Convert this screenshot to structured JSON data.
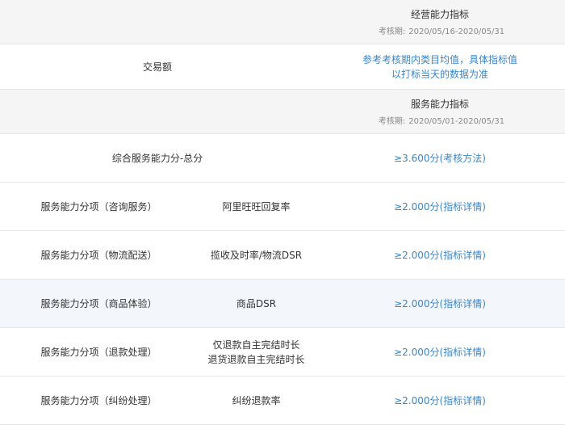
{
  "sections": {
    "business": {
      "title": "经营能力指标",
      "period_label": "考核期:",
      "period_value": "2020/05/16-2020/05/31"
    },
    "service": {
      "title": "服务能力指标",
      "period_label": "考核期:",
      "period_value": "2020/05/01-2020/05/31"
    }
  },
  "trade_row": {
    "label": "交易额",
    "note_line1": "参考考核期内类目均值，具体指标值",
    "note_line2": "以打标当天的数据为准"
  },
  "total_row": {
    "label": "综合服务能力分-总分",
    "link": "≥3.600分(考核方法)"
  },
  "rows": [
    {
      "category": "服务能力分项（咨询服务）",
      "metric_line1": "阿里旺旺回复率",
      "metric_line2": "",
      "link": "≥2.000分(指标详情)"
    },
    {
      "category": "服务能力分项（物流配送）",
      "metric_line1": "揽收及时率/物流DSR",
      "metric_line2": "",
      "link": "≥2.000分(指标详情)"
    },
    {
      "category": "服务能力分项（商品体验）",
      "metric_line1": "商品DSR",
      "metric_line2": "",
      "link": "≥2.000分(指标详情)"
    },
    {
      "category": "服务能力分项（退款处理）",
      "metric_line1": "仅退款自主完结时长",
      "metric_line2": "退货退款自主完结时长",
      "link": "≥2.000分(指标详情)"
    },
    {
      "category": "服务能力分项（纠纷处理）",
      "metric_line1": "纠纷退款率",
      "metric_line2": "",
      "link": "≥2.000分(指标详情)"
    }
  ],
  "colors": {
    "link": "#3a86c8",
    "section_bg": "#f5f5f5",
    "highlight_bg": "#f3f7fc"
  }
}
